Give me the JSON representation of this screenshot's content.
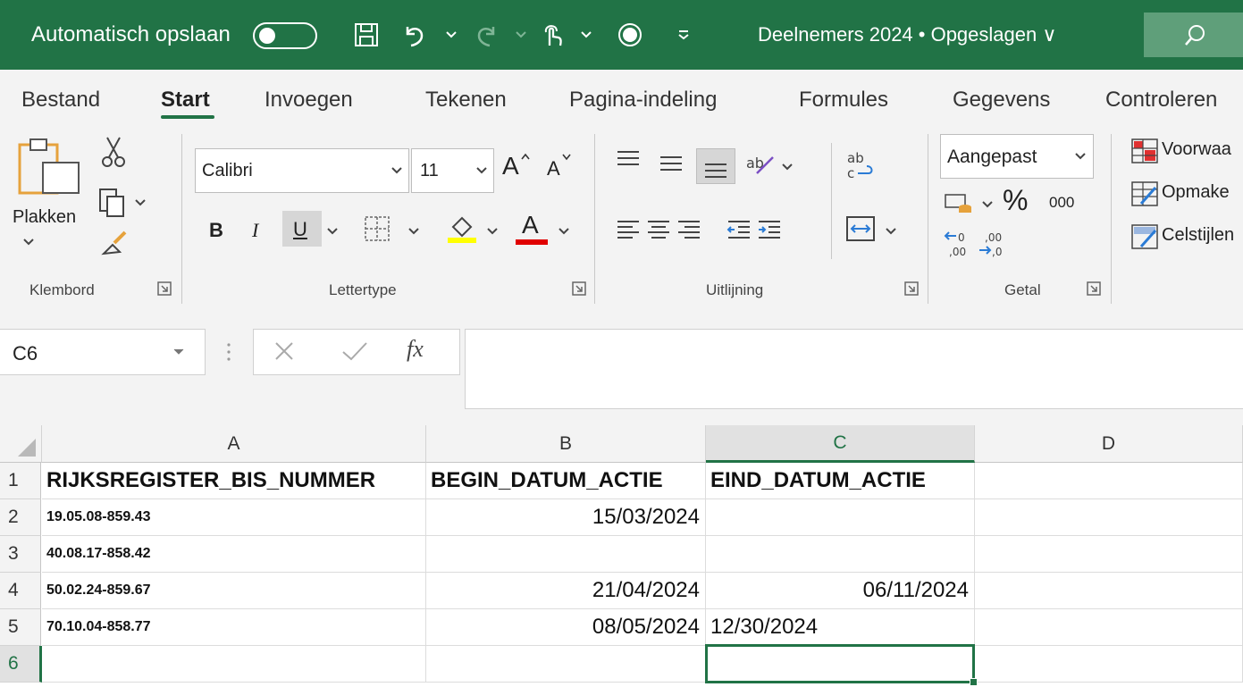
{
  "titlebar": {
    "autosave_label": "Automatisch opslaan",
    "document_title": "Deelnemers 2024 • Opgeslagen ∨"
  },
  "ribbon": {
    "tabs": [
      "Bestand",
      "Start",
      "Invoegen",
      "Tekenen",
      "Pagina-indeling",
      "Formules",
      "Gegevens",
      "Controleren"
    ],
    "active_tab": "Start",
    "clipboard": {
      "paste_label": "Plakken",
      "group_label": "Klembord"
    },
    "font": {
      "name": "Calibri",
      "size": "11",
      "bold": "B",
      "italic": "I",
      "underline": "U",
      "color_letter": "A",
      "grow": "A",
      "shrink": "A",
      "group_label": "Lettertype"
    },
    "alignment": {
      "group_label": "Uitlijning"
    },
    "number": {
      "format": "Aangepast",
      "percent": "%",
      "thousands": "000",
      "group_label": "Getal"
    },
    "styles": {
      "conditional": "Voorwaa",
      "format_table": "Opmake",
      "cell_styles": "Celstijlen"
    }
  },
  "formula_bar": {
    "name_box": "C6",
    "fx": "fx",
    "value": ""
  },
  "grid": {
    "columns": [
      "A",
      "B",
      "C",
      "D"
    ],
    "selected_column": "C",
    "rows": [
      "1",
      "2",
      "3",
      "4",
      "5",
      "6"
    ],
    "selected_row": "6",
    "header": [
      "RIJKSREGISTER_BIS_NUMMER",
      "BEGIN_DATUM_ACTIE",
      "EIND_DATUM_ACTIE"
    ],
    "data": [
      {
        "a": "19.05.08-859.43",
        "b": "15/03/2024",
        "c": ""
      },
      {
        "a": "40.08.17-858.42",
        "b": "",
        "c": ""
      },
      {
        "a": "50.02.24-859.67",
        "b": "21/04/2024",
        "c": "06/11/2024"
      },
      {
        "a": "70.10.04-858.77",
        "b": "08/05/2024",
        "c": "12/30/2024"
      }
    ]
  },
  "colors": {
    "accent": "#217346",
    "ribbon_bg": "#f3f3f3",
    "highlight_yellow": "#ffff00",
    "font_red": "#e00000"
  }
}
